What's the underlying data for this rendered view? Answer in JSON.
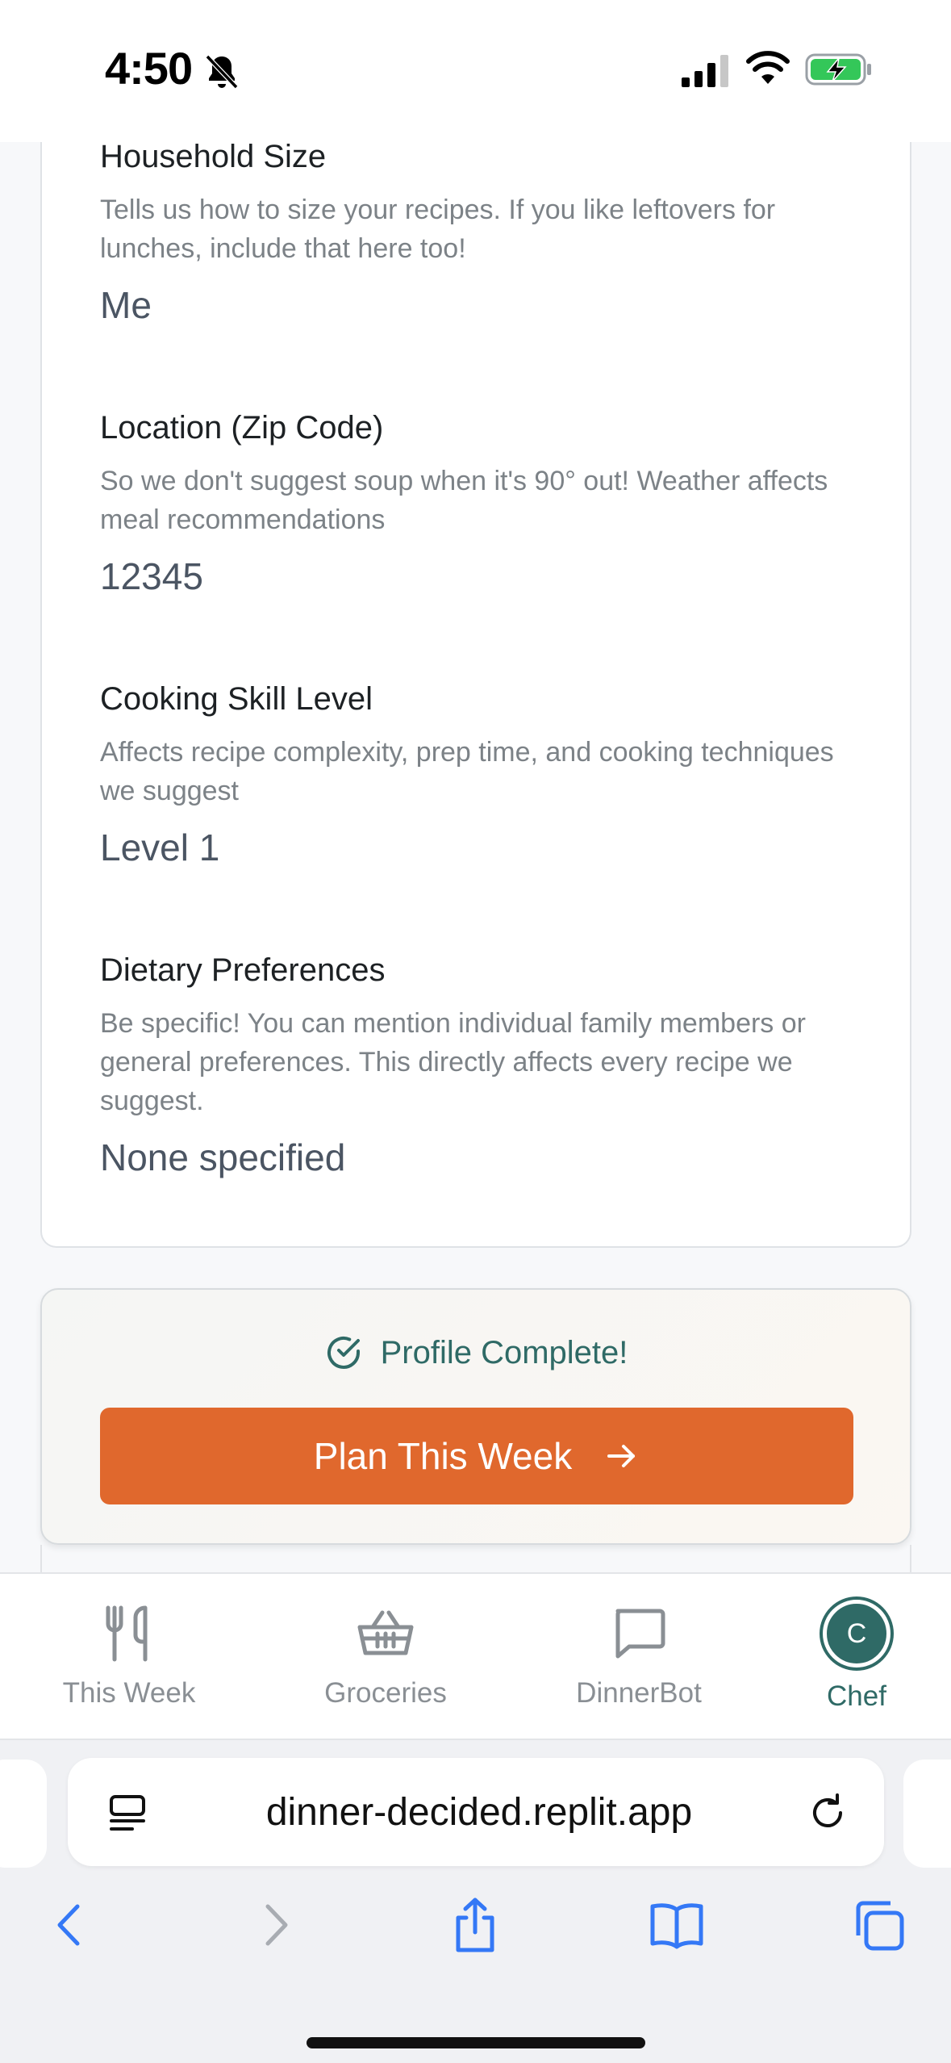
{
  "status_bar": {
    "time": "4:50",
    "icons": [
      "bell-slash-icon",
      "cellular-signal-icon",
      "wifi-icon",
      "battery-charging-icon"
    ]
  },
  "profile": {
    "fields": [
      {
        "label": "Household Size",
        "help": "Tells us how to size your recipes. If you like leftovers for lunches, include that here too!",
        "value": "Me"
      },
      {
        "label": "Location (Zip Code)",
        "help": "So we don't suggest soup when it's 90° out! Weather affects meal recommendations",
        "value": "12345"
      },
      {
        "label": "Cooking Skill Level",
        "help": "Affects recipe complexity, prep time, and cooking techniques we suggest",
        "value": "Level 1"
      },
      {
        "label": "Dietary Preferences",
        "help": "Be specific! You can mention individual family members or general preferences. This directly affects every recipe we suggest.",
        "value": "None specified"
      }
    ]
  },
  "completion": {
    "status_text": "Profile Complete!",
    "button_label": "Plan This Week"
  },
  "nav": {
    "items": [
      {
        "label": "This Week",
        "icon": "fork-knife-icon"
      },
      {
        "label": "Groceries",
        "icon": "basket-icon"
      },
      {
        "label": "DinnerBot",
        "icon": "chat-bubble-icon"
      },
      {
        "label": "Chef",
        "icon": "avatar",
        "avatar_letter": "C",
        "active": true
      }
    ]
  },
  "browser": {
    "url": "dinner-decided.replit.app",
    "toolbar": [
      "back-icon",
      "forward-icon",
      "share-icon",
      "bookmarks-icon",
      "tabs-icon"
    ]
  },
  "colors": {
    "accent_teal": "#2f6a66",
    "button_orange": "#e0682d",
    "ios_blue": "#3478f6"
  }
}
